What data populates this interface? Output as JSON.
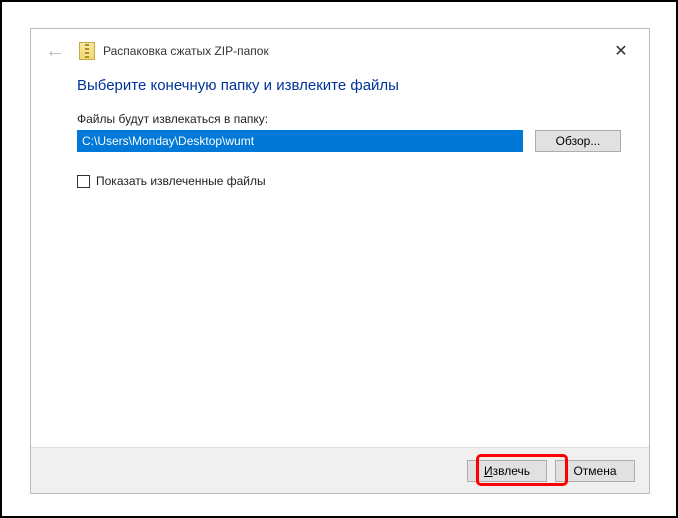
{
  "titlebar": {
    "title": "Распаковка сжатых ZIP-папок"
  },
  "content": {
    "heading": "Выберите конечную папку и извлеките файлы",
    "path_label": "Файлы будут извлекаться в папку:",
    "path_value": "C:\\Users\\Monday\\Desktop\\wumt",
    "browse_label": "Обзор...",
    "show_extracted_label": "Показать извлеченные файлы"
  },
  "footer": {
    "extract_label": "Извлечь",
    "cancel_label": "Отмена"
  }
}
